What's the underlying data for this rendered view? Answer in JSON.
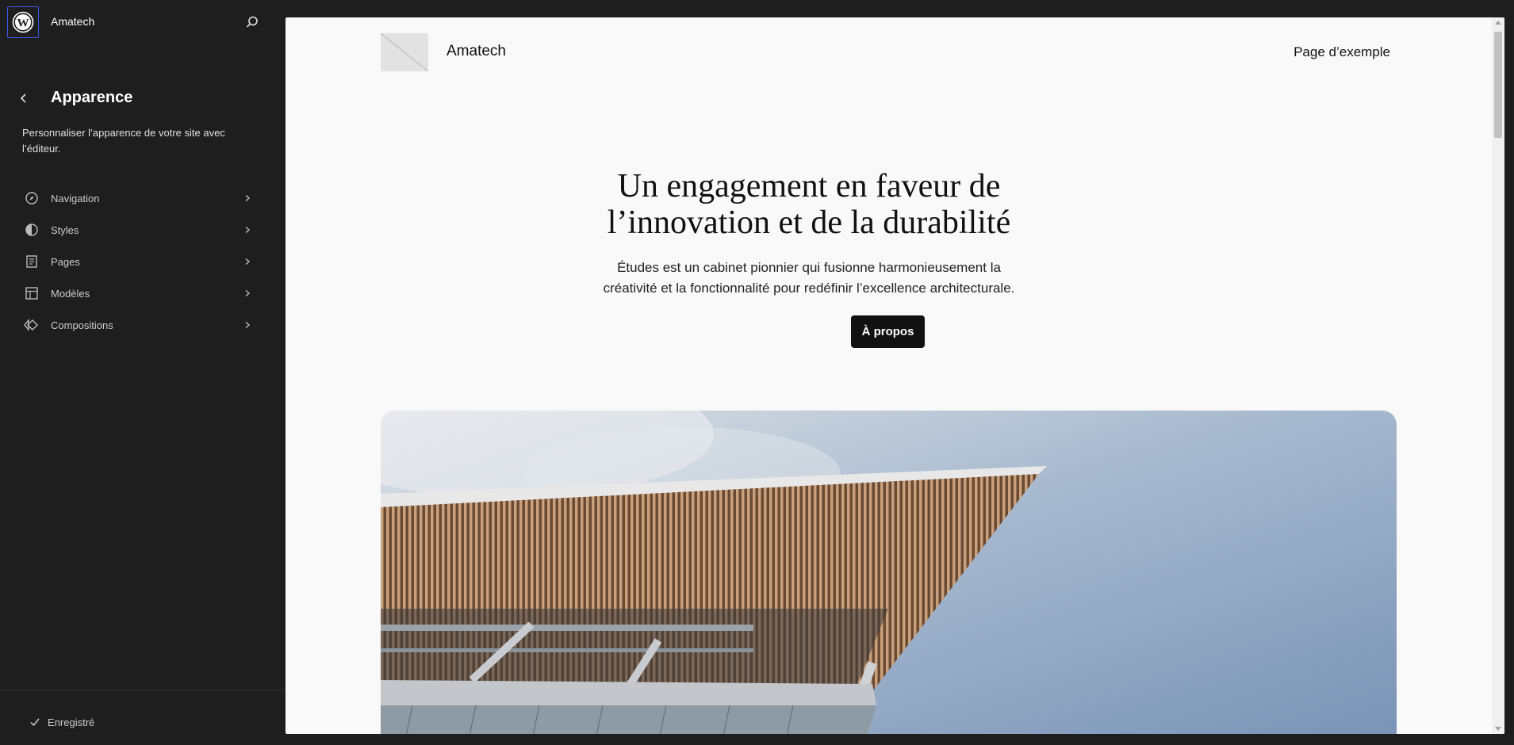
{
  "header": {
    "logo_icon": "wordpress-logo-icon",
    "site_name": "Amatech",
    "search_icon": "search-icon"
  },
  "panel": {
    "back_icon": "chevron-left-icon",
    "title": "Apparence",
    "description": "Personnaliser l’apparence de votre site avec l’éditeur."
  },
  "nav": {
    "items": [
      {
        "label": "Navigation",
        "icon": "navigation-compass-icon"
      },
      {
        "label": "Styles",
        "icon": "styles-contrast-icon"
      },
      {
        "label": "Pages",
        "icon": "page-icon"
      },
      {
        "label": "Modèles",
        "icon": "layout-template-icon"
      },
      {
        "label": "Compositions",
        "icon": "symbol-diamond-icon"
      }
    ],
    "chevron_icon": "chevron-right-icon"
  },
  "footer": {
    "status_icon": "check-icon",
    "status_label": "Enregistré"
  },
  "preview": {
    "site_title": "Amatech",
    "nav_link": "Page d’exemple",
    "hero_heading": "Un engagement en faveur de l’innovation et de la durabilité",
    "hero_text": "Études est un cabinet pionnier qui fusionne harmonieusement la créativité et la fonctionnalité pour redéfinir l’excellence architecturale.",
    "hero_button": "À propos"
  },
  "colors": {
    "sidebar_bg": "#1e1e1e",
    "accent": "#3858e9",
    "canvas_bg": "#f9f9f9",
    "button_bg": "#111111"
  }
}
